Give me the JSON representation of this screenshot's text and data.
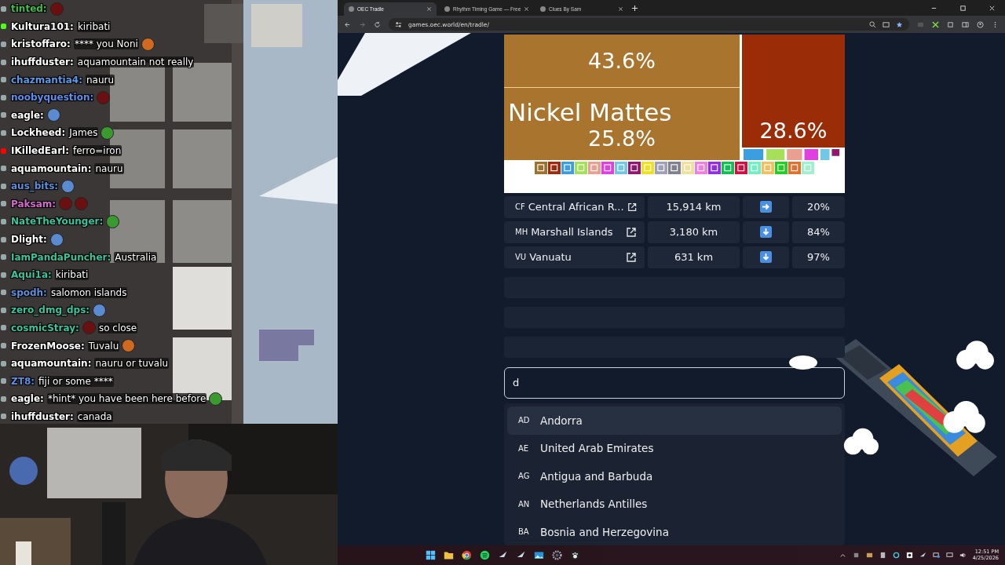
{
  "chat": [
    {
      "user": "tinted:",
      "color": "#3ec04a",
      "parts": [
        {
          "kind": "round_emote"
        }
      ]
    },
    {
      "badge": {
        "kind": "kick"
      },
      "user": "Kultura101:",
      "color": "#ffffff",
      "parts": [
        {
          "kind": "text",
          "text": "kiribati"
        }
      ]
    },
    {
      "user": "kristoffaro:",
      "color": "#ffffff",
      "parts": [
        {
          "kind": "text",
          "text": "**** you Noni"
        },
        {
          "kind": "critter_emote"
        }
      ]
    },
    {
      "user": "ihuffduster:",
      "color": "#ffffff",
      "parts": [
        {
          "kind": "text",
          "text": "aquamountain not really"
        }
      ]
    },
    {
      "user": "chazmantia4:",
      "color": "#5a9ae8",
      "parts": [
        {
          "kind": "text",
          "text": "nauru"
        }
      ]
    },
    {
      "user": "noobyquestion:",
      "color": "#5a90f0",
      "parts": [
        {
          "kind": "round_emote"
        }
      ]
    },
    {
      "user": "eagle:",
      "color": "#ffffff",
      "parts": [
        {
          "kind": "figure_emote"
        }
      ]
    },
    {
      "user": "Lockheed:",
      "color": "#ffffff",
      "parts": [
        {
          "kind": "text",
          "text": "James"
        },
        {
          "kind": "frog_emote"
        }
      ]
    },
    {
      "badge": {
        "kind": "youtube"
      },
      "user": "IKilledEarl:",
      "color": "#ffffff",
      "parts": [
        {
          "kind": "text",
          "text": "ferro=iron"
        }
      ]
    },
    {
      "user": "aquamountain:",
      "color": "#ffffff",
      "parts": [
        {
          "kind": "text",
          "text": "nauru"
        }
      ]
    },
    {
      "user": "aus_bits:",
      "color": "#5a90e0",
      "parts": [
        {
          "kind": "figure_emote"
        }
      ]
    },
    {
      "user": "Paksam:",
      "color": "#d868d0",
      "parts": [
        {
          "kind": "round_emote"
        },
        {
          "kind": "round_emote"
        }
      ]
    },
    {
      "user": "NateTheYounger:",
      "color": "#34c8a0",
      "parts": [
        {
          "kind": "frog_emote"
        }
      ]
    },
    {
      "user": "Dlight:",
      "color": "#ffffff",
      "parts": [
        {
          "kind": "figure_emote"
        }
      ]
    },
    {
      "user": "IamPandaPuncher:",
      "color": "#34c8a0",
      "parts": [
        {
          "kind": "text",
          "text": "Australia"
        }
      ]
    },
    {
      "user": "Aqui1a:",
      "color": "#34c8a0",
      "parts": [
        {
          "kind": "text",
          "text": "kiribati"
        }
      ]
    },
    {
      "user": "spodh:",
      "color": "#5a90e0",
      "parts": [
        {
          "kind": "text",
          "text": "salomon islands"
        }
      ]
    },
    {
      "user": "zero_dmg_dps:",
      "color": "#34c8a0",
      "parts": [
        {
          "kind": "figure_emote"
        }
      ]
    },
    {
      "user": "cosmicStray:",
      "color": "#34c8a0",
      "parts": [
        {
          "kind": "round_emote"
        },
        {
          "kind": "text",
          "text": "so close"
        }
      ]
    },
    {
      "user": "FrozenMoose:",
      "color": "#ffffff",
      "parts": [
        {
          "kind": "text",
          "text": "Tuvalu"
        },
        {
          "kind": "critter_emote"
        }
      ]
    },
    {
      "user": "aquamountain:",
      "color": "#ffffff",
      "parts": [
        {
          "kind": "text",
          "text": "nauru or tuvalu"
        }
      ]
    },
    {
      "user": "ZT8:",
      "color": "#5a90e8",
      "parts": [
        {
          "kind": "text",
          "text": "fiji or some ****"
        }
      ]
    },
    {
      "user": "eagle:",
      "color": "#ffffff",
      "parts": [
        {
          "kind": "text",
          "text": "*hint* you have been here before"
        },
        {
          "kind": "frog_emote"
        }
      ]
    },
    {
      "user": "ihuffduster:",
      "color": "#ffffff",
      "parts": [
        {
          "kind": "text",
          "text": "canada"
        }
      ]
    }
  ],
  "browser": {
    "tabs": [
      {
        "title": "OEC Tradle",
        "selected": true
      },
      {
        "title": "Rhythm Timing Game — Free",
        "selected": false
      },
      {
        "title": "Clues By Sam",
        "selected": false
      }
    ],
    "url": "games.oec.world/en/tradle/"
  },
  "treemap": {
    "tiles": [
      {
        "share": "43.6%",
        "color": "#a8742e"
      },
      {
        "label": "Nickel Mattes",
        "share": "25.8%",
        "color": "#a8742e"
      },
      {
        "share": "28.6%",
        "color": "#9a2c08"
      }
    ],
    "legend": [
      {
        "color": "#a0712e"
      },
      {
        "color": "#9b2c0e"
      },
      {
        "color": "#3a9ee0"
      },
      {
        "color": "#a6e05a"
      },
      {
        "color": "#e8a090"
      },
      {
        "color": "#e040e0"
      },
      {
        "color": "#70c8e8"
      },
      {
        "color": "#901870"
      },
      {
        "color": "#f0e020"
      },
      {
        "color": "#a0a0b8"
      },
      {
        "color": "#808090"
      },
      {
        "color": "#f0e0a0"
      },
      {
        "color": "#f080e0"
      },
      {
        "color": "#9030e0"
      },
      {
        "color": "#10c050"
      },
      {
        "color": "#d01040"
      },
      {
        "color": "#70f0c0"
      },
      {
        "color": "#f0c060"
      },
      {
        "color": "#20d020"
      },
      {
        "color": "#e07030"
      },
      {
        "color": "#a0f0d0"
      }
    ]
  },
  "guesses": [
    {
      "kind": "guess",
      "code": "CF",
      "country": "Central African R...",
      "distance": "15,914 km",
      "direction": {
        "kind": "right"
      },
      "proximity": "20%"
    },
    {
      "kind": "guess",
      "code": "MH",
      "country": "Marshall Islands",
      "distance": "3,180 km",
      "direction": {
        "kind": "down"
      },
      "proximity": "84%"
    },
    {
      "kind": "guess",
      "code": "VU",
      "country": "Vanuatu",
      "distance": "631 km",
      "direction": {
        "kind": "down"
      },
      "proximity": "97%"
    },
    {
      "kind": "blank"
    },
    {
      "kind": "blank"
    },
    {
      "kind": "blank"
    }
  ],
  "search": {
    "value": "d"
  },
  "options": [
    {
      "code": "AD",
      "name": "Andorra",
      "selected": true
    },
    {
      "code": "AE",
      "name": "United Arab Emirates",
      "selected": false
    },
    {
      "code": "AG",
      "name": "Antigua and Barbuda",
      "selected": false
    },
    {
      "code": "AN",
      "name": "Netherlands Antilles",
      "selected": false
    },
    {
      "code": "BA",
      "name": "Bosnia and Herzegovina",
      "selected": false
    }
  ],
  "taskbar": {
    "time": "12:51 PM",
    "date": "4/25/2026"
  }
}
